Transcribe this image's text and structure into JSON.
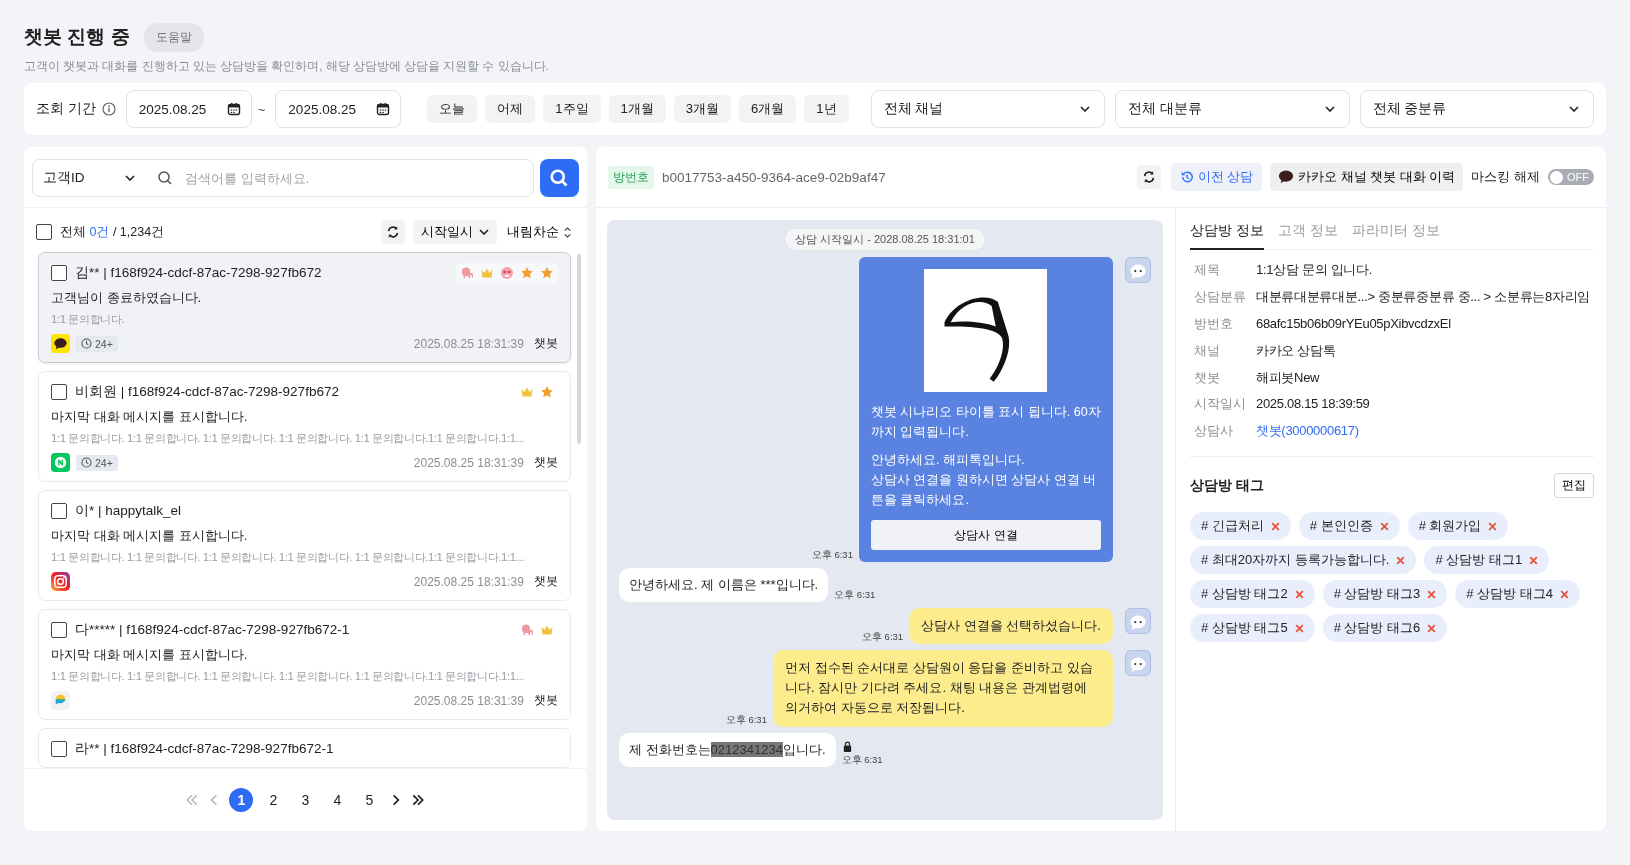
{
  "header": {
    "title": "챗봇 진행 중",
    "help_button": "도움말",
    "description": "고객이 챗봇과 대화를 진행하고 있는 상담방을 확인하며, 해당 상담방에 상담을 지원할 수 있습니다."
  },
  "filter": {
    "label": "조회 기간",
    "start_date": "2025.08.25",
    "separator": "~",
    "end_date": "2025.08.25",
    "quick_ranges": [
      {
        "label": "오늘",
        "selected": false
      },
      {
        "label": "어제",
        "selected": false
      },
      {
        "label": "1주일",
        "selected": false
      },
      {
        "label": "1개월",
        "selected": false
      },
      {
        "label": "3개월",
        "selected": false
      },
      {
        "label": "6개월",
        "selected": false
      },
      {
        "label": "1년",
        "selected": false
      }
    ],
    "selects": [
      "전체 채널",
      "전체 대분류",
      "전체 중분류"
    ]
  },
  "search": {
    "type": "고객ID",
    "placeholder": "검색어를 입력하세요."
  },
  "list_header": {
    "select_all_checked": false,
    "all_label": "전체",
    "selected_count": "0건",
    "total": "/ 1,234건",
    "sort": "시작일시",
    "order": "내림차순"
  },
  "conversations": [
    {
      "checked": false,
      "selected": true,
      "title": "김** | f168f924-cdcf-87ac-7298-927fb672",
      "badges": [
        {
          "kind": "elephant"
        },
        {
          "kind": "crown"
        },
        {
          "kind": "face"
        },
        {
          "kind": "star"
        },
        {
          "kind": "star"
        }
      ],
      "last_message": "고객님이 종료하였습니다.",
      "preview": "1:1 문의합니다.",
      "channel": {
        "kind": "kakao"
      },
      "wait": "24+",
      "time": "2025.08.25 18:31:39",
      "handler": "챗봇"
    },
    {
      "checked": false,
      "selected": false,
      "title": "비회원 | f168f924-cdcf-87ac-7298-927fb672",
      "badges": [
        {
          "kind": "crown"
        },
        {
          "kind": "star"
        }
      ],
      "last_message": "마지막 대화 메시지를 표시합니다.",
      "preview": "1:1 문의합니다. 1:1 문의합니다. 1:1 문의합니다. 1:1 문의합니다. 1:1 문의합니다.1:1 문의합니다.1:1...",
      "channel": {
        "kind": "naver"
      },
      "wait": "24+",
      "time": "2025.08.25 18:31:39",
      "handler": "챗봇"
    },
    {
      "checked": false,
      "selected": false,
      "title": "이* | happytalk_el",
      "last_message": "마지막 대화 메시지를 표시합니다.",
      "preview": "1:1 문의합니다. 1:1 문의합니다. 1:1 문의합니다. 1:1 문의합니다. 1:1 문의합니다.1:1 문의합니다.1:1...",
      "channel": {
        "kind": "instagram"
      },
      "time": "2025.08.25 18:31:39",
      "handler": "챗봇"
    },
    {
      "checked": false,
      "selected": false,
      "title": "다***** | f168f924-cdcf-87ac-7298-927fb672-1",
      "badges": [
        {
          "kind": "elephant"
        },
        {
          "kind": "crown"
        }
      ],
      "last_message": "마지막 대화 메시지를 표시합니다.",
      "preview": "1:1 문의합니다. 1:1 문의합니다. 1:1 문의합니다. 1:1 문의합니다. 1:1 문의합니다.1:1 문의합니다.1:1...",
      "channel": {
        "kind": "chat"
      },
      "time": "2025.08.25 18:31:39",
      "handler": "챗봇"
    },
    {
      "checked": false,
      "selected": false,
      "title": "라** | f168f924-cdcf-87ac-7298-927fb672-1"
    }
  ],
  "pagination": {
    "pages": [
      {
        "label": "1",
        "selected": true
      },
      {
        "label": "2",
        "selected": false
      },
      {
        "label": "3",
        "selected": false
      },
      {
        "label": "4",
        "selected": false
      },
      {
        "label": "5",
        "selected": false
      }
    ]
  },
  "room": {
    "label": "방번호",
    "id": "b0017753-a450-9364-ace9-02b9af47",
    "previous_button": "이전 상담",
    "history_button": "카카오 채널 챗봇 대화 이력",
    "masking_label": "마스킹 해제",
    "masking_on": false,
    "toggle_text": "OFF"
  },
  "messages": [
    {
      "kind": "system",
      "text": "상담 시작일시 - 2028.08.25 18:31:01"
    },
    {
      "kind": "bot_card",
      "title": "챗봇 시나리오 타이틀 표시 됩니다. 60자까지 입력됩니다.",
      "body": "안녕하세요. 해피톡입니다.\n상담사 연결을 원하시면 상담사 연결 버튼을 클릭하세요.",
      "button": "상담사 연결",
      "time": "오후 6:31"
    },
    {
      "kind": "customer",
      "text": "안녕하세요. 제 이름은 ***입니다.",
      "time": "오후 6:31"
    },
    {
      "kind": "bot",
      "text": "상담사 연결을 선택하셨습니다.",
      "time": "오후 6:31"
    },
    {
      "kind": "bot",
      "text": "먼저 접수된 순서대로 상담원이 응답을 준비하고 있습니다. 잠시만 기다려 주세요. 채팅 내용은 관계법령에 의거하여 자동으로 저장됩니다.",
      "time": "오후 6:31"
    },
    {
      "kind": "customer",
      "text": "제 전화번호는",
      "masked": "0212341234",
      "text_after": "입니다.",
      "locked": true,
      "time": "오후 6:31"
    }
  ],
  "info": {
    "tabs": [
      {
        "label": "상담방 정보",
        "selected": true
      },
      {
        "label": "고객 정보",
        "selected": false
      },
      {
        "label": "파라미터 정보",
        "selected": false
      }
    ],
    "fields": [
      {
        "label": "제목",
        "value": "1:1상담 문의 입니다."
      },
      {
        "label": "상담분류",
        "value": "대분류대분류대분...> 중분류중분류 중...   > 소분류는8자리임"
      },
      {
        "label": "방번호",
        "value": "68afc15b06b09rYEu05pXibvcdzxEl"
      },
      {
        "label": "채널",
        "value": "카카오 상담톡"
      },
      {
        "label": "챗봇",
        "value": "해피봇New"
      },
      {
        "label": "시작일시",
        "value": "2025.08.15 18:39:59"
      },
      {
        "label": "상담사",
        "value": "챗봇(3000000617)",
        "kind": "link"
      }
    ],
    "tags_title": "상담방 태그",
    "edit_button": "편집",
    "tags": [
      "# 긴급처리",
      "# 본인인증",
      "# 회원가입",
      "# 최대20자까지 등록가능합니다.",
      "# 상담방 태그1",
      "# 상담방 태그2",
      "# 상담방 태그3",
      "# 상담방 태그4",
      "# 상담방 태그5",
      "# 상담방 태그6"
    ]
  }
}
